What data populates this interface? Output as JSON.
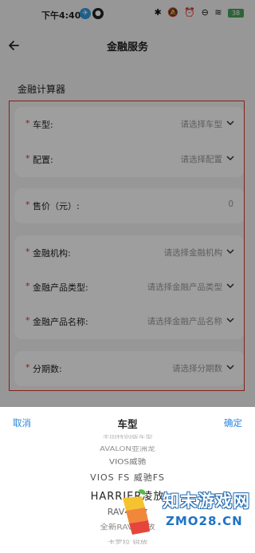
{
  "status_bar": {
    "time": "下午4:40",
    "battery": "38"
  },
  "header": {
    "title": "金融服务"
  },
  "section_title": "金融计算器",
  "form": {
    "car_model": {
      "label": "车型:",
      "placeholder": "请选择车型"
    },
    "config": {
      "label": "配置:",
      "placeholder": "请选择配置"
    },
    "price": {
      "label": "售价（元）:",
      "value": "0"
    },
    "institution": {
      "label": "金融机构:",
      "placeholder": "请选择金融机构"
    },
    "product_type": {
      "label": "金融产品类型:",
      "placeholder": "请选择金融产品类型"
    },
    "product_name": {
      "label": "金融产品名称:",
      "placeholder": "请选择金融产品名称"
    },
    "installments": {
      "label": "分期数:",
      "placeholder": "请选择分期数"
    }
  },
  "picker": {
    "cancel": "取消",
    "title": "车型",
    "confirm": "确定",
    "options": [
      "丰田特别版车型",
      "AVALON亚洲龙",
      "VIOS威驰",
      "VIOS FS 威驰FS",
      "HARRIER凌放",
      "RAV4荣放",
      "全新RAV4荣放",
      "卡罗拉 锐放"
    ]
  },
  "watermark": {
    "text": "知末游戏网",
    "sub": "ZMO28.CN"
  },
  "colors": {
    "required": "#e0302b",
    "accent": "#2e86de",
    "highlight_box": "#d9342b"
  }
}
